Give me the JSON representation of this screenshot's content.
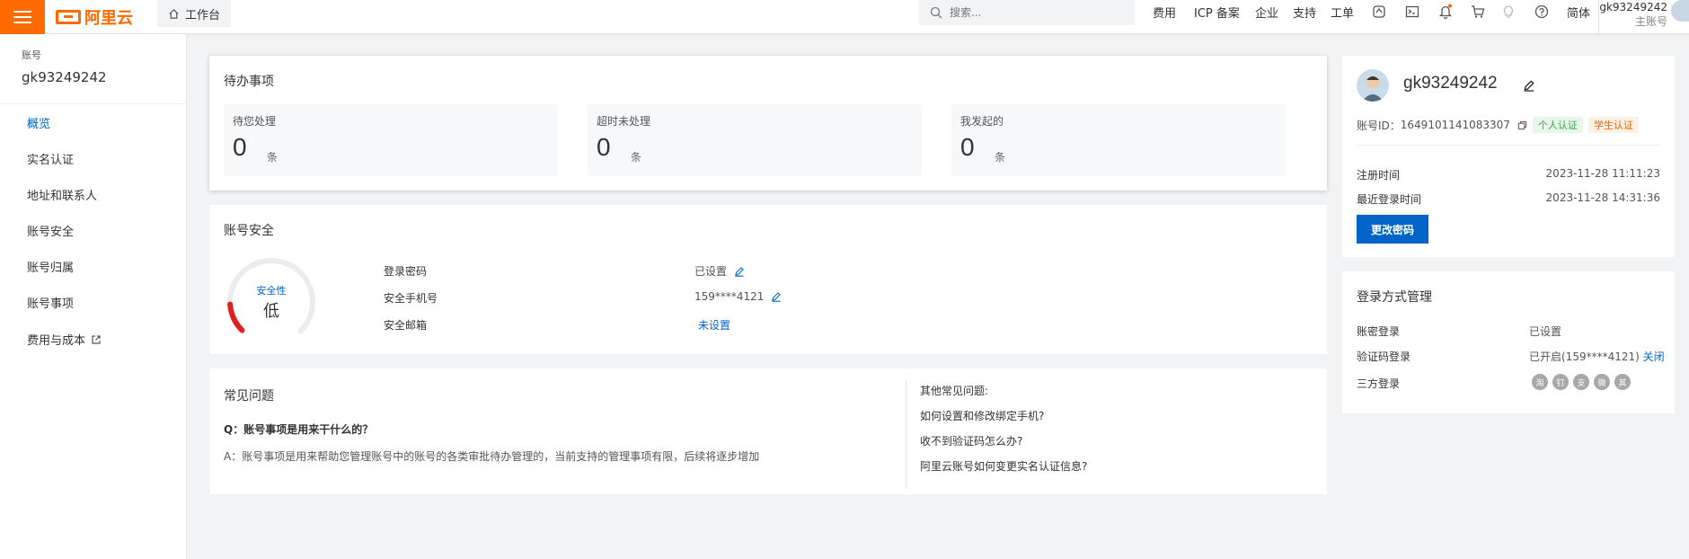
{
  "topbar": {
    "brand": "阿里云",
    "workbench": "工作台",
    "search_placeholder": "搜索...",
    "nav": [
      "费用",
      "ICP 备案",
      "企业",
      "支持",
      "工单"
    ],
    "lang": "简体",
    "user_name": "gk93249242",
    "user_role": "主账号",
    "brand_color": "#ff6a00"
  },
  "sidebar": {
    "label": "账号",
    "account": "gk93249242",
    "items": [
      "概览",
      "实名认证",
      "地址和联系人",
      "账号安全",
      "账号归属",
      "账号事项",
      "费用与成本"
    ]
  },
  "todo": {
    "title": "待办事项",
    "boxes": [
      {
        "label": "待您处理",
        "count": "0",
        "unit": "条"
      },
      {
        "label": "超时未处理",
        "count": "0",
        "unit": "条"
      },
      {
        "label": "我发起的",
        "count": "0",
        "unit": "条"
      }
    ]
  },
  "security": {
    "title": "账号安全",
    "gauge_label": "安全性",
    "gauge_value": "低",
    "level_fraction": 0.15,
    "rows": [
      {
        "label": "登录密码",
        "value": "已设置"
      },
      {
        "label": "安全手机号",
        "value": "159****4121"
      },
      {
        "label": "安全邮箱",
        "value": "未设置"
      }
    ]
  },
  "faq": {
    "title": "常见问题",
    "question": "Q：账号事项是用来干什么的？",
    "answer": "A：账号事项是用来帮助您管理账号中的账号的各类审批待办管理的，当前支持的管理事项有限，后续将逐步增加",
    "other_title": "其他常见问题:",
    "other": [
      "如何设置和修改绑定手机?",
      "收不到验证码怎么办?",
      "阿里云账号如何变更实名认证信息?"
    ]
  },
  "profile": {
    "name": "gk93249242",
    "id_label": "账号ID：",
    "id_value": "1649101141083307",
    "tag_personal": "个人认证",
    "tag_student": "学生认证",
    "reg_label": "注册时间",
    "reg_value": "2023-11-28 11:11:23",
    "login_label": "最近登录时间",
    "login_value": "2023-11-28 14:31:36",
    "change_pwd": "更改密码"
  },
  "login_mgmt": {
    "title": "登录方式管理",
    "pwd_label": "账密登录",
    "pwd_value": "已设置",
    "code_label": "验证码登录",
    "code_value": "已开启(159****4121)",
    "code_action": "关闭",
    "third_label": "三方登录",
    "third_icons": [
      "淘",
      "钉",
      "支",
      "微",
      "其"
    ]
  },
  "colors": {
    "accent": "#0064c8",
    "danger": "#e02020"
  }
}
